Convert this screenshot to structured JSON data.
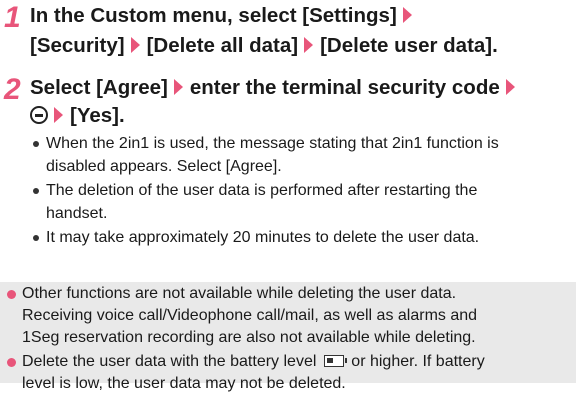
{
  "steps": [
    {
      "number": "1",
      "line1": {
        "a": "In the Custom menu, select [Settings]"
      },
      "line2": {
        "a": "[Security]",
        "b": "[Delete all data]",
        "c": "[Delete user data]."
      }
    },
    {
      "number": "2",
      "line1": {
        "a": "Select [Agree]",
        "b": "enter the terminal security code"
      },
      "line2": {
        "b": "[Yes]."
      }
    }
  ],
  "bullets": [
    {
      "line1": "When the 2in1 is used, the message stating that 2in1 function is",
      "line2": "disabled appears. Select [Agree]."
    },
    {
      "line1": "The deletion of the user data is performed after restarting the",
      "line2": "handset."
    },
    {
      "line1": "It may take approximately 20 minutes to delete the user data."
    }
  ],
  "notes": [
    {
      "line1": "Other functions are not available while deleting the user data.",
      "line2": "Receiving voice call/Videophone call/mail, as well as alarms and",
      "line3": "1Seg reservation recording are also not available while deleting."
    },
    {
      "line1a": "Delete the user data with the battery level",
      "line1b": "or higher. If battery",
      "line2": "level is low, the user data may not be deleted."
    }
  ],
  "icons": {
    "arrow": "arrow-right-icon",
    "minus_key": "minus-key-icon",
    "battery": "battery-level-icon"
  },
  "colors": {
    "accent": "#e8557a",
    "note_background": "#e9e9e9",
    "text": "#1a1a1a"
  }
}
